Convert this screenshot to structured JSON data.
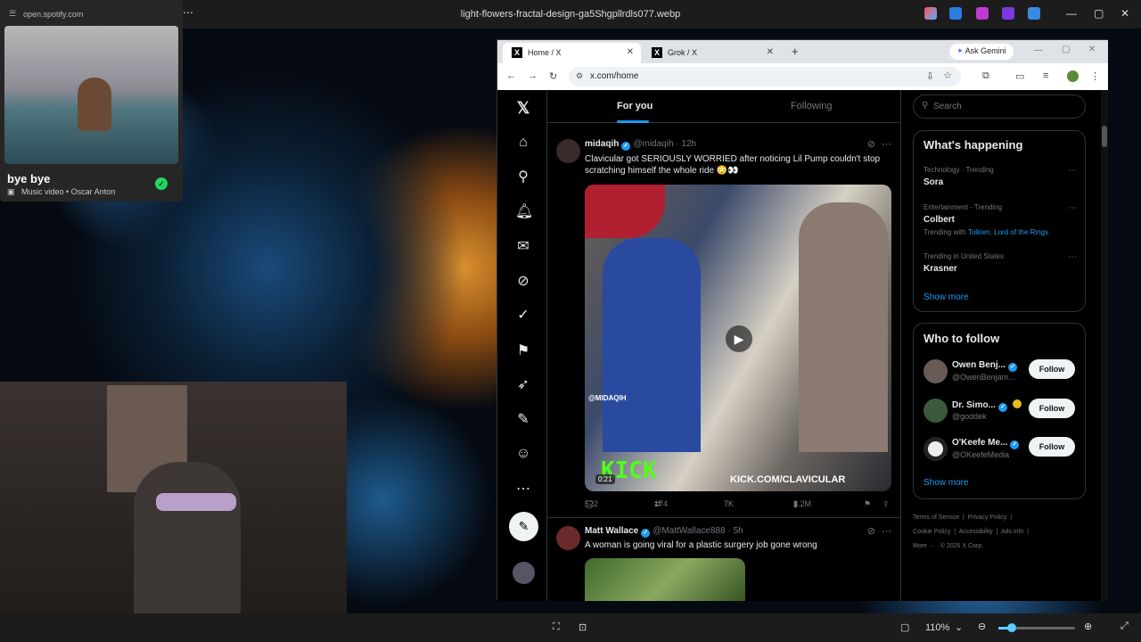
{
  "viewer": {
    "title": "light-flowers-fractal-design-ga5Shgpllrdls077.webp",
    "zoom": "110%"
  },
  "spotify": {
    "url": "open.spotify.com",
    "song": "bye bye",
    "subtitle": "Music video • Oscar Anton"
  },
  "browser": {
    "tabs": [
      {
        "label": "Home / X"
      },
      {
        "label": "Grok / X"
      }
    ],
    "ask_gemini": "Ask Gemini",
    "url": "x.com/home"
  },
  "x": {
    "feed_tabs": [
      "For you",
      "Following"
    ],
    "posts": [
      {
        "name": "midaqih",
        "handle": "@midaqih · 12h",
        "text": "Clavicular got SERIOUSLY WORRIED after noticing Lil Pump couldn't stop scratching himself the whole ride 😳👀",
        "media_watermark": "@MIDAQIH",
        "media_kick": "KICK",
        "media_url": "KICK.COM/CLAVICULAR",
        "duration": "0:21",
        "replies": "522",
        "reposts": "174",
        "likes": "7K",
        "views": "3.2M"
      },
      {
        "name": "Matt Wallace",
        "handle": "@MattWallace888 · 5h",
        "text": "A woman is going viral for a plastic surgery job gone wrong"
      }
    ],
    "search_placeholder": "Search",
    "whats_happening": {
      "title": "What's happening",
      "trends": [
        {
          "context": "Technology · Trending",
          "name": "Sora",
          "with": ""
        },
        {
          "context": "Entertainment · Trending",
          "name": "Colbert",
          "with_prefix": "Trending with",
          "with": "Tolkien, Lord of the Rings"
        },
        {
          "context": "Trending in United States",
          "name": "Krasner",
          "with": ""
        }
      ],
      "show_more": "Show more"
    },
    "who_to_follow": {
      "title": "Who to follow",
      "accounts": [
        {
          "name": "Owen Benj...",
          "handle": "@OwenBenjam...",
          "button": "Follow"
        },
        {
          "name": "Dr. Simo...",
          "handle": "@goddek",
          "button": "Follow"
        },
        {
          "name": "O'Keefe Me...",
          "handle": "@OKeefeMedia",
          "button": "Follow"
        }
      ],
      "show_more": "Show more"
    },
    "footer": [
      "Terms of Service",
      "Privacy Policy",
      "Cookie Policy",
      "Accessibility",
      "Ads info",
      "More ···",
      "© 2026 X Corp."
    ]
  }
}
